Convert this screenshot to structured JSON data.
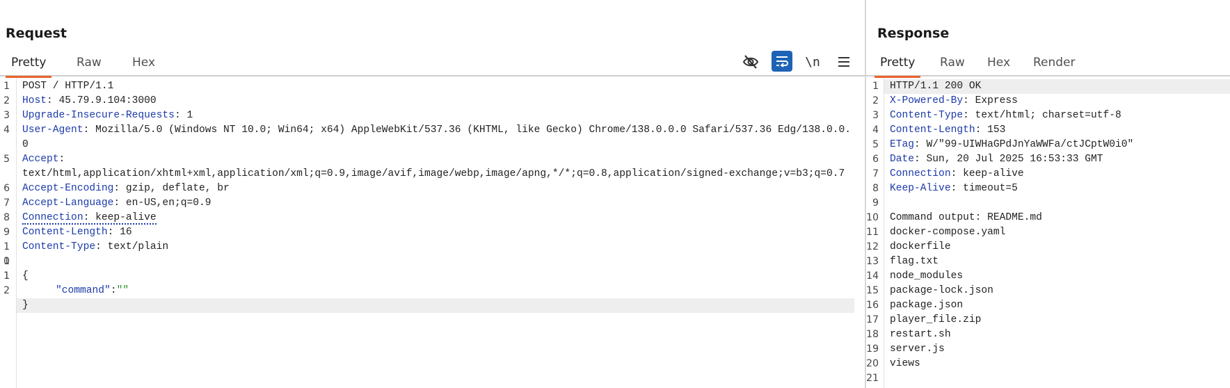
{
  "request": {
    "title": "Request",
    "tabs": [
      "Pretty",
      "Raw",
      "Hex"
    ],
    "active_tab": "Pretty",
    "toolbar": {
      "hide_icon": "eye-slash-icon",
      "wrap_icon": "word-wrap-icon",
      "newline_label": "\\n",
      "menu_icon": "hamburger-menu-icon"
    },
    "line_numbers": [
      "1",
      "2",
      "3",
      "4",
      "5",
      "6",
      "7",
      "8",
      "9",
      "10",
      "11",
      "12"
    ],
    "lines": {
      "l1": "POST / HTTP/1.1",
      "l2_k": "Host",
      "l2_v": ": 45.79.9.104:3000",
      "l3_k": "Upgrade-Insecure-Requests",
      "l3_v": ": 1",
      "l4_k": "User-Agent",
      "l4_v": ": Mozilla/5.0 (Windows NT 10.0; Win64; x64) AppleWebKit/537.36 (KHTML, like Gecko) Chrome/138.0.0.0 Safari/537.36 Edg/138.0.0.0",
      "l5_k": "Accept",
      "l5_v": ":\ntext/html,application/xhtml+xml,application/xml;q=0.9,image/avif,image/webp,image/apng,*/*;q=0.8,application/signed-exchange;v=b3;q=0.7",
      "l6_k": "Accept-Encoding",
      "l6_v": ": gzip, deflate, br",
      "l7_k": "Accept-Language",
      "l7_v": ": en-US,en;q=0.9",
      "l8_k": "Connection",
      "l8_v": ": keep-alive",
      "l9_k": "Content-Length",
      "l9_v": ": 16",
      "l10_k": "Content-Type",
      "l10_v": ": text/plain",
      "l11": "",
      "l12": "{",
      "l13_k": "\"command\"",
      "l13_sep": ":",
      "l13_v": "\"\"",
      "l14": "}"
    }
  },
  "response": {
    "title": "Response",
    "tabs": [
      "Pretty",
      "Raw",
      "Hex",
      "Render"
    ],
    "active_tab": "Pretty",
    "line_numbers": [
      "1",
      "2",
      "3",
      "4",
      "5",
      "6",
      "7",
      "8",
      "9",
      "10",
      "11",
      "12",
      "13",
      "14",
      "15",
      "16",
      "17",
      "18",
      "19",
      "20",
      "21"
    ],
    "lines": {
      "l1": "HTTP/1.1 200 OK",
      "l2_k": "X-Powered-By",
      "l2_v": ": Express",
      "l3_k": "Content-Type",
      "l3_v": ": text/html; charset=utf-8",
      "l4_k": "Content-Length",
      "l4_v": ": 153",
      "l5_k": "ETag",
      "l5_v": ": W/\"99-UIWHaGPdJnYaWWFa/ctJCptW0i0\"",
      "l6_k": "Date",
      "l6_v": ": Sun, 20 Jul 2025 16:53:33 GMT",
      "l7_k": "Connection",
      "l7_v": ": keep-alive",
      "l8_k": "Keep-Alive",
      "l8_v": ": timeout=5",
      "l9": "",
      "l10": "Command output: README.md",
      "l11": "docker-compose.yaml",
      "l12": "dockerfile",
      "l13": "flag.txt",
      "l14": "node_modules",
      "l15": "package-lock.json",
      "l16": "package.json",
      "l17": "player_file.zip",
      "l18": "restart.sh",
      "l19": "server.js",
      "l20": "views",
      "l21": ""
    }
  }
}
